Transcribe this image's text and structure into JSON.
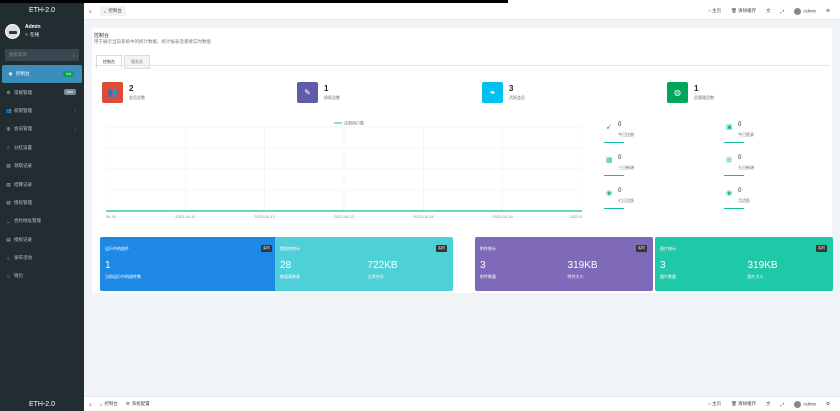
{
  "brand": "ETH-2.0",
  "user": {
    "name": "Admin",
    "status": "在线"
  },
  "search": {
    "placeholder": "搜索菜单"
  },
  "menu": [
    {
      "label": "控制台",
      "badge": "hot",
      "badge_color": "#00a65a",
      "active": true,
      "icon": "dashboard-icon"
    },
    {
      "label": "常规管理",
      "badge": "new",
      "badge_color": "#7a8a99",
      "icon": "gear-icon"
    },
    {
      "label": "权限管理",
      "chev": "‹",
      "icon": "users-icon"
    },
    {
      "label": "会员管理",
      "chev": "‹",
      "icon": "user-icon"
    },
    {
      "label": "分红设置",
      "icon": "circle-icon"
    },
    {
      "label": "领取记录",
      "icon": "list-icon"
    },
    {
      "label": "结算记录",
      "icon": "list-icon"
    },
    {
      "label": "授权管理",
      "icon": "list-icon"
    },
    {
      "label": "合约地址管理",
      "icon": "link-icon"
    },
    {
      "label": "授权记录",
      "icon": "list-icon"
    },
    {
      "label": "发布活动",
      "icon": "circle-icon"
    },
    {
      "label": "钱包",
      "icon": "circle-icon"
    }
  ],
  "topnav": {
    "tab": "控制台",
    "home": "主页",
    "clear": "清除缓存",
    "user": "Admin"
  },
  "bottomnav": {
    "tabs": [
      "控制台",
      "系统配置"
    ],
    "home": "主页",
    "clear": "清除缓存",
    "user": "Admin"
  },
  "panel": {
    "title": "控制台",
    "subtitle": "用于展示当前系统中的统计数据、统计报表及重要实时数据",
    "tabs": [
      "控制台",
      "相关文"
    ]
  },
  "stats": [
    {
      "value": "2",
      "label": "会员总数",
      "color": "#dd4b39",
      "icon": "users-icon"
    },
    {
      "value": "1",
      "label": "授权总数",
      "color": "#605ca8",
      "icon": "pen-icon"
    },
    {
      "value": "3",
      "label": "活跃会员",
      "color": "#00c0ef",
      "icon": "leaf-icon"
    },
    {
      "value": "1",
      "label": "总管理员数",
      "color": "#00a65a",
      "icon": "user-icon"
    }
  ],
  "chart_data": {
    "type": "line",
    "series": [
      {
        "name": "注册用户数",
        "values": [
          0,
          0,
          0,
          0,
          0,
          0,
          0
        ]
      }
    ],
    "categories": [
      "04-10",
      "2023-04-11",
      "2023-04-12",
      "2023-04-13",
      "2023-04-14",
      "2023-04-15",
      "2023-0"
    ],
    "ylim": [
      0,
      5
    ],
    "grid": true
  },
  "right_stats": [
    {
      "value": "0",
      "label": "今日注册",
      "icon": "rocket-icon"
    },
    {
      "value": "0",
      "label": "今日登录",
      "icon": "id-card-icon"
    },
    {
      "value": "0",
      "label": "三日新增",
      "icon": "calendar-icon"
    },
    {
      "value": "0",
      "label": "七日新增",
      "icon": "calendar-plus-icon"
    },
    {
      "value": "0",
      "label": "七日活跃",
      "icon": "user-circle-icon"
    },
    {
      "value": "0",
      "label": "月活跃",
      "icon": "user-circle-icon"
    }
  ],
  "cards": [
    {
      "title": "运行中的插件",
      "badge": "实时",
      "v1": "1",
      "l1": "当前运行中的插件数",
      "v2": "",
      "l2": "",
      "color": "#1e88e5"
    },
    {
      "title": "数据库统计",
      "badge": "实时",
      "v1": "28",
      "l1": "数据表数量",
      "v2": "722KB",
      "l2": "占用空间",
      "color": "#4dd0d7"
    },
    {
      "title": "附件统计",
      "badge": "实时",
      "v1": "3",
      "l1": "附件数量",
      "v2": "319KB",
      "l2": "附件大小",
      "color": "#7e6ab8"
    },
    {
      "title": "图片统计",
      "badge": "实时",
      "v1": "3",
      "l1": "图片数量",
      "v2": "319KB",
      "l2": "图片大小",
      "color": "#1fc9a8"
    }
  ]
}
